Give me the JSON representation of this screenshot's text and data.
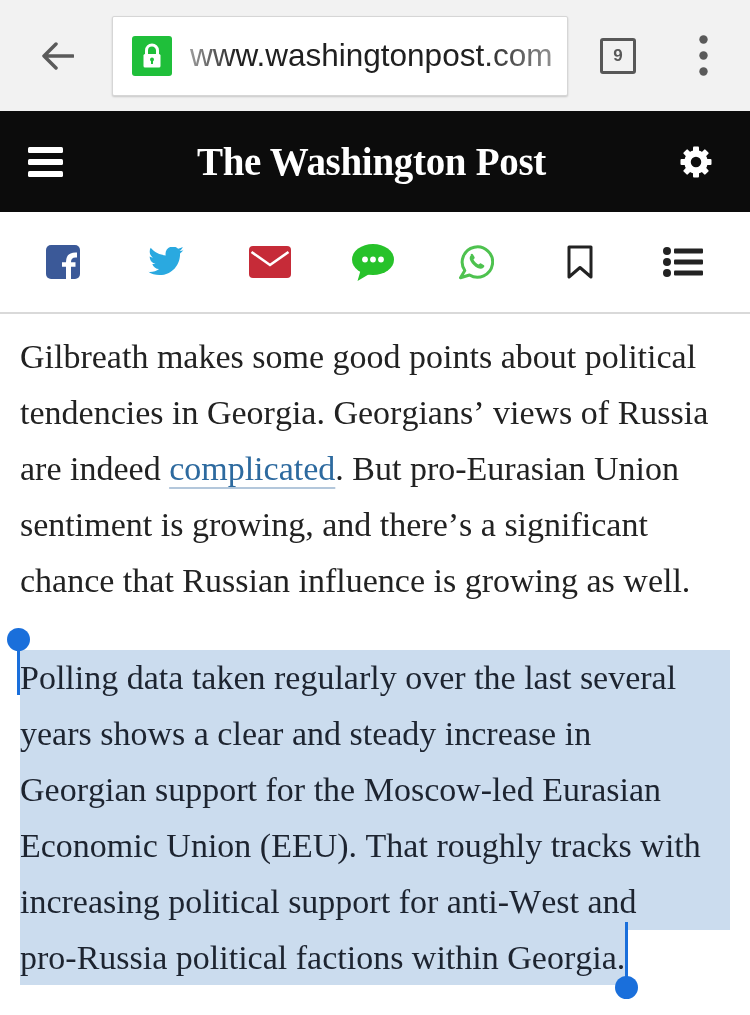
{
  "browser": {
    "secure": true,
    "address": "www.washingtonpost.com",
    "tab_count": "9"
  },
  "header": {
    "logo": "The Washington Post"
  },
  "share_bar": [
    {
      "kind": "facebook"
    },
    {
      "kind": "twitter"
    },
    {
      "kind": "email"
    },
    {
      "kind": "sms"
    },
    {
      "kind": "whatsapp"
    },
    {
      "kind": "bookmark"
    },
    {
      "kind": "list"
    }
  ],
  "article": [
    {
      "selected": false,
      "segments": [
        {
          "kind": "text",
          "text": "Gilbreath makes some good points about political tendencies in Georgia. Georgians’ views of Russia are indeed "
        },
        {
          "kind": "link",
          "text": "complicated"
        },
        {
          "kind": "text",
          "text": ". But pro-Eurasian Union sentiment is growing, and there’s a significant chance that Russian influence is growing as well."
        }
      ]
    },
    {
      "selected": true,
      "segments": [
        {
          "kind": "text",
          "text": "Polling data taken regularly over the last several years shows a clear and steady increase in Georgian support for the Moscow-led Eurasian Economic Union (EEU). That roughly tracks with increasing political support for anti-West and pro-Russia political factions within Georgia."
        }
      ]
    }
  ]
}
